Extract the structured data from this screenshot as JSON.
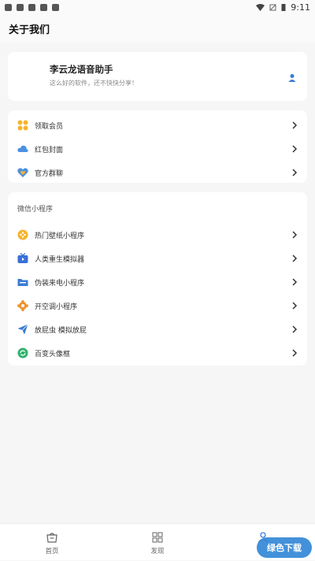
{
  "status_bar": {
    "time": "9:11"
  },
  "header": {
    "title": "关于我们"
  },
  "profile": {
    "name": "李云龙语音助手",
    "slogan": "这么好的软件，还不快快分享！"
  },
  "menu": [
    {
      "label": "领取会员",
      "icon": "grid-icon",
      "color": "#f5b52f"
    },
    {
      "label": "红包封面",
      "icon": "cloud-icon",
      "color": "#4a90e2"
    },
    {
      "label": "官方群聊",
      "icon": "heart-chat-icon",
      "color": "#4a90e2"
    }
  ],
  "mini_programs": {
    "title": "微信小程序",
    "items": [
      {
        "label": "热门壁纸小程序",
        "icon": "gamepad-icon",
        "color": "#f5b52f"
      },
      {
        "label": "人类重生模拟器",
        "icon": "tv-icon",
        "color": "#3a6fd8"
      },
      {
        "label": "伪装来电小程序",
        "icon": "folder-icon",
        "color": "#3a7bd5"
      },
      {
        "label": "开空调小程序",
        "icon": "gear-icon",
        "color": "#f0922e"
      },
      {
        "label": "放屁虫 模拟放屁",
        "icon": "send-icon",
        "color": "#3a7bd5"
      },
      {
        "label": "百变头像框",
        "icon": "refresh-icon",
        "color": "#2fb36e"
      }
    ]
  },
  "bottom_nav": [
    {
      "label": "首页",
      "icon": "basket-icon"
    },
    {
      "label": "发现",
      "icon": "grid-outline-icon"
    },
    {
      "label": "",
      "icon": "person-icon"
    }
  ],
  "watermark": {
    "text": "绿色下载"
  }
}
